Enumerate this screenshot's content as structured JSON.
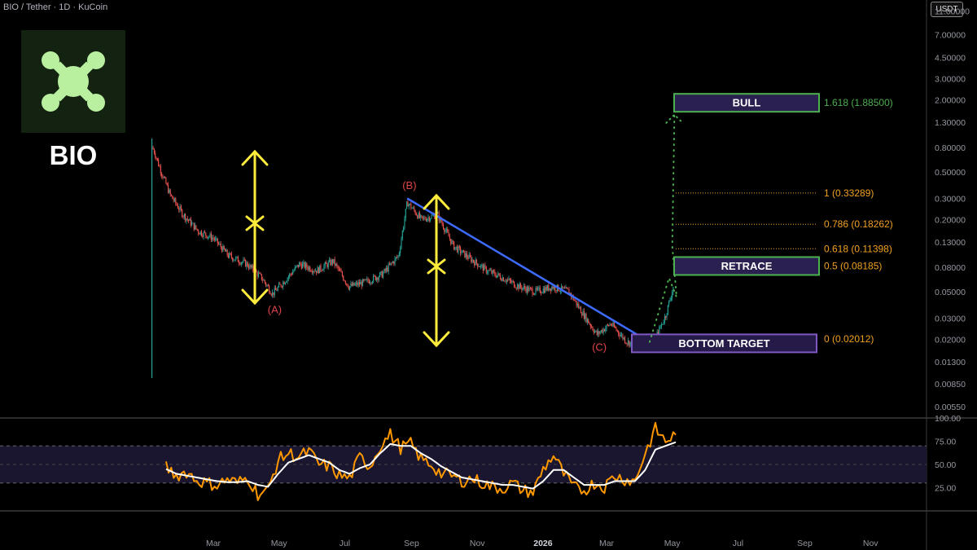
{
  "header": {
    "title": "BIO / Tether · 1D · KuCoin",
    "currency": "USDT"
  },
  "brand": {
    "label": "BIO",
    "logo_icon": "bio-splat-icon",
    "logo_color": "#b8f0a0",
    "logo_bg": "#142311"
  },
  "colors": {
    "up": "#26a69a",
    "down": "#ef5350",
    "trendline": "#3d6bff",
    "arrow": "#ffeb3b",
    "wave_label": "#e0444a",
    "fib": "#f0a020",
    "fib_top": "#4caf50",
    "projection": "#4caf50",
    "rsi": "#ff9800",
    "rsi_ma": "#ffffff"
  },
  "chart_data": [
    {
      "type": "line",
      "scale": "log",
      "y_ticks": [
        "11.00000",
        "7.00000",
        "4.50000",
        "3.00000",
        "2.00000",
        "1.30000",
        "0.80000",
        "0.50000",
        "0.30000",
        "0.20000",
        "0.13000",
        "0.08000",
        "0.05000",
        "0.03000",
        "0.02000",
        "0.01300",
        "0.00850",
        "0.00550"
      ],
      "x_ticks": [
        "Mar",
        "May",
        "Jul",
        "Sep",
        "Nov",
        "2026",
        "Mar",
        "May",
        "Jul",
        "Sep",
        "Nov"
      ],
      "price_series": {
        "dates": [
          "2025-01-03",
          "2025-01-05",
          "2025-01-10",
          "2025-01-20",
          "2025-02-01",
          "2025-02-15",
          "2025-03-01",
          "2025-03-15",
          "2025-04-01",
          "2025-04-15",
          "2025-04-25",
          "2025-05-05",
          "2025-05-20",
          "2025-06-05",
          "2025-06-20",
          "2025-07-05",
          "2025-07-20",
          "2025-08-05",
          "2025-08-20",
          "2025-08-28",
          "2025-09-10",
          "2025-09-25",
          "2025-10-10",
          "2025-10-25",
          "2025-11-10",
          "2025-11-25",
          "2025-12-10",
          "2025-12-25",
          "2026-01-10",
          "2026-01-25",
          "2026-02-05",
          "2026-02-20",
          "2026-03-05",
          "2026-03-20",
          "2026-04-05",
          "2026-04-15",
          "2026-04-25",
          "2026-05-02"
        ],
        "close": [
          0.8,
          0.75,
          0.55,
          0.32,
          0.22,
          0.16,
          0.14,
          0.1,
          0.085,
          0.065,
          0.048,
          0.06,
          0.085,
          0.075,
          0.09,
          0.055,
          0.06,
          0.07,
          0.1,
          0.28,
          0.2,
          0.22,
          0.12,
          0.095,
          0.075,
          0.065,
          0.055,
          0.05,
          0.055,
          0.05,
          0.035,
          0.022,
          0.027,
          0.019,
          0.018,
          0.02,
          0.032,
          0.055
        ]
      },
      "wick_high": 0.95,
      "wick_low": 0.0095,
      "wave_labels": [
        {
          "label": "(A)",
          "date": "2025-04-25",
          "value": 0.048
        },
        {
          "label": "(B)",
          "date": "2025-08-28",
          "value": 0.28
        },
        {
          "label": "(C)",
          "date": "2026-02-20",
          "value": 0.022
        }
      ],
      "trendline": {
        "from": {
          "date": "2025-08-28",
          "value": 0.3
        },
        "to": {
          "date": "2026-04-10",
          "value": 0.019
        }
      },
      "fib_levels": [
        {
          "label": "0 (0.02012)",
          "value": 0.02012
        },
        {
          "label": "0.5 (0.08185)",
          "value": 0.08185
        },
        {
          "label": "0.618 (0.11398)",
          "value": 0.11398
        },
        {
          "label": "0.786 (0.18262)",
          "value": 0.18262
        },
        {
          "label": "1 (0.33289)",
          "value": 0.33289
        },
        {
          "label": "1.618 (1.88500)",
          "value": 1.885
        }
      ],
      "target_boxes": [
        {
          "label": "BULL",
          "value": 1.885,
          "style": "green"
        },
        {
          "label": "RETRACE",
          "value": 0.0818,
          "style": "green"
        },
        {
          "label": "BOTTOM TARGET",
          "value": 0.0185,
          "style": "purple"
        }
      ],
      "projection": [
        {
          "date": "2026-04-10",
          "value": 0.019
        },
        {
          "date": "2026-04-28",
          "value": 0.065
        },
        {
          "date": "2026-05-05",
          "value": 0.045
        },
        {
          "date": "2026-05-01",
          "value": 0.12
        },
        {
          "date": "2026-05-03",
          "value": 1.5
        }
      ]
    },
    {
      "type": "line",
      "y_ticks": [
        "100.00",
        "75.00",
        "50.00",
        "25.00"
      ],
      "ylim": [
        0,
        100
      ],
      "bands": [
        30,
        70
      ],
      "series": [
        {
          "values": [
            47,
            38,
            42,
            33,
            30,
            28,
            34,
            30,
            36,
            18,
            22,
            55,
            62,
            58,
            64,
            50,
            48,
            38,
            35,
            58,
            48,
            70,
            82,
            68,
            72,
            56,
            50,
            40,
            38,
            32,
            35,
            30,
            26,
            24,
            30,
            22,
            20,
            45,
            60,
            40,
            25,
            22,
            30,
            26,
            38,
            34,
            32,
            62,
            88,
            75,
            82
          ]
        },
        {
          "values": [
            45,
            40,
            38,
            36,
            34,
            32,
            31,
            31,
            32,
            28,
            26,
            40,
            52,
            56,
            60,
            56,
            52,
            44,
            40,
            46,
            50,
            62,
            72,
            70,
            70,
            62,
            56,
            48,
            42,
            36,
            34,
            32,
            30,
            28,
            28,
            26,
            24,
            32,
            44,
            44,
            36,
            28,
            28,
            28,
            32,
            32,
            32,
            44,
            66,
            70,
            74
          ]
        }
      ]
    }
  ]
}
